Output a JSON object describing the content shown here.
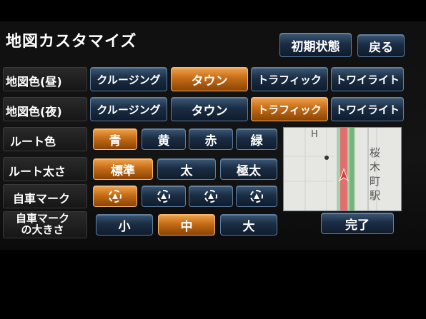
{
  "header": {
    "title": "地図カスタマイズ",
    "reset_label": "初期状態",
    "back_label": "戻る"
  },
  "rows": {
    "map_color_day": {
      "label": "地図色(昼)",
      "options": [
        "クルージング",
        "タウン",
        "トラフィック",
        "トワイライト"
      ],
      "selected_index": 1
    },
    "map_color_night": {
      "label": "地図色(夜)",
      "options": [
        "クルージング",
        "タウン",
        "トラフィック",
        "トワイライト"
      ],
      "selected_index": 2
    },
    "route_color": {
      "label": "ルート色",
      "options": [
        "青",
        "黄",
        "赤",
        "緑"
      ],
      "selected_index": 0
    },
    "route_width": {
      "label": "ルート太さ",
      "options": [
        "標準",
        "太",
        "極太"
      ],
      "selected_index": 0
    },
    "car_mark": {
      "label": "自車マーク",
      "icon_count": 4,
      "selected_index": 0
    },
    "car_mark_size": {
      "label_line1": "自車マーク",
      "label_line2": "の大きさ",
      "options": [
        "小",
        "中",
        "大"
      ],
      "selected_index": 1
    }
  },
  "done_label": "完了",
  "map_preview": {
    "station_chars": [
      "桜",
      "木",
      "町",
      "駅"
    ],
    "h_mark": "H"
  },
  "colors": {
    "button_blue": "#1b2d44",
    "button_selected_orange": "#c56c17",
    "route_green": "#76b57a",
    "route_red": "#e07070"
  }
}
